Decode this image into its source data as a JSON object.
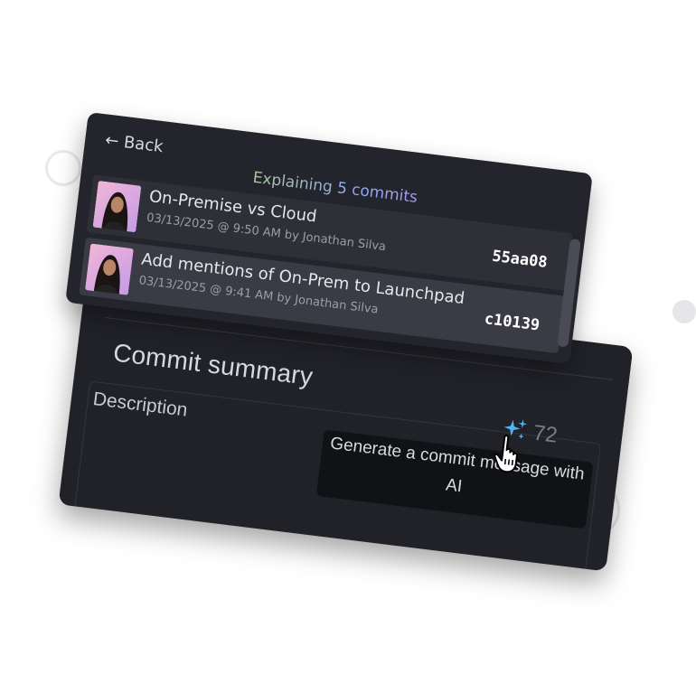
{
  "header": {
    "back_label": "Back",
    "title": "Explaining 5 commits"
  },
  "commits": [
    {
      "title": "On-Premise vs Cloud",
      "meta": "03/13/2025 @ 9:50 AM by Jonathan Silva",
      "hash": "55aa08"
    },
    {
      "title": "Add mentions of On-Prem to Launchpad",
      "meta": "03/13/2025 @ 9:41 AM by Jonathan Silva",
      "hash": "c10139"
    }
  ],
  "summary": {
    "title": "Commit summary",
    "description_label": "Description",
    "char_count": "72",
    "ai_tooltip": "Generate a commit message with AI"
  },
  "icons": {
    "back": "arrow-left-icon",
    "ai": "sparkle-icon",
    "cursor": "hand-pointer-icon"
  },
  "colors": {
    "panel_bg": "#24252c",
    "selected_row": "#3a3b44",
    "ai_accent": "#4fb3f6"
  }
}
